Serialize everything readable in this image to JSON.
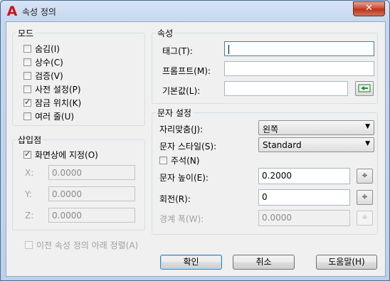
{
  "window": {
    "title": "속성 정의",
    "app_icon": "A",
    "close_glyph": "✕"
  },
  "mode": {
    "title": "모드",
    "items": [
      {
        "label": "숨김(I)",
        "checked": false
      },
      {
        "label": "상수(C)",
        "checked": false
      },
      {
        "label": "검증(V)",
        "checked": false
      },
      {
        "label": "사전 설정(P)",
        "checked": false
      },
      {
        "label": "잠금 위치(K)",
        "checked": true
      },
      {
        "label": "여러 줄(U)",
        "checked": false
      }
    ]
  },
  "attribute": {
    "title": "속성",
    "tag_label": "태그(T):",
    "tag_value": "",
    "prompt_label": "프롬프트(M):",
    "prompt_value": "",
    "default_label": "기본값(L):",
    "default_value": "",
    "field_button_icon": "insert-field-icon"
  },
  "insertion": {
    "title": "삽입점",
    "specify_label": "화면상에 지정(O)",
    "specify_checked": true,
    "x_label": "X:",
    "x_value": "0.0000",
    "y_label": "Y:",
    "y_value": "0.0000",
    "z_label": "Z:",
    "z_value": "0.0000"
  },
  "text_settings": {
    "title": "문자 설정",
    "justification_label": "자리맞춤(J):",
    "justification_value": "왼쪽",
    "style_label": "문자 스타일(S):",
    "style_value": "Standard",
    "annotative_label": "주석(N)",
    "annotative_checked": false,
    "height_label": "문자 높이(E):",
    "height_value": "0.2000",
    "rotation_label": "회전(R):",
    "rotation_value": "0",
    "boundary_label": "경계 폭(W):",
    "boundary_value": "0.0000"
  },
  "align_below": {
    "label": "이전 속성 정의 아래 정렬(A)",
    "checked": false
  },
  "buttons": {
    "ok": "확인",
    "cancel": "취소",
    "help": "도움말(H)"
  },
  "colors": {
    "titlebar": "#c5d7ee",
    "close": "#c7442a",
    "app_icon": "#c8141a"
  }
}
